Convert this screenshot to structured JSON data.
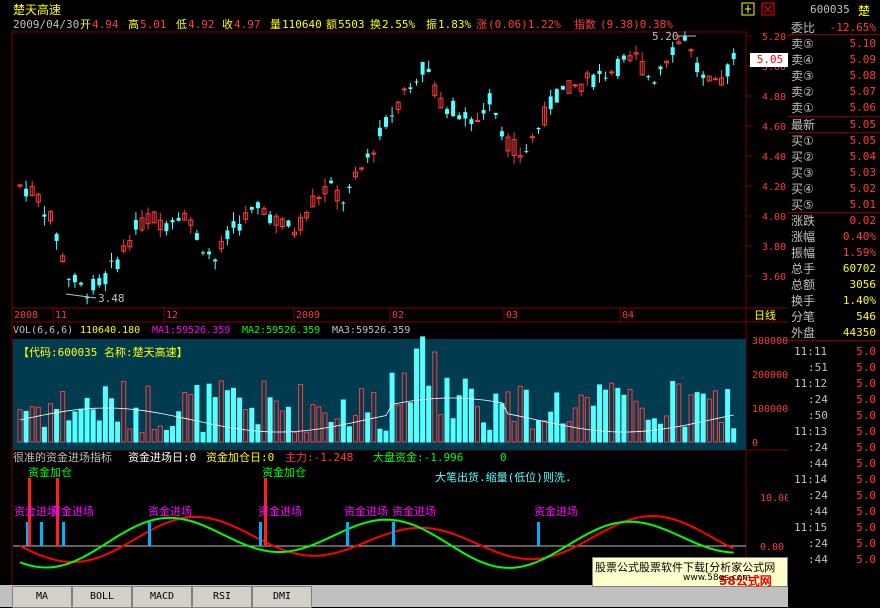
{
  "stock": {
    "name": "楚天高速",
    "code": "600035",
    "name_short": "楚",
    "date": "2009/04/30",
    "open_label": "开",
    "open": "4.94",
    "high_label": "高",
    "high": "5.01",
    "low_label": "低",
    "low": "4.92",
    "close_label": "收",
    "close": "4.97",
    "vol_label": "量",
    "vol": "110640",
    "amt_label": "额",
    "amt": "5503",
    "turn_label": "换",
    "turn": "2.55%",
    "amp_label": "振",
    "amp": "1.83%",
    "chg_label": "涨",
    "chg": "(0.06)1.22%",
    "idx_label": "指数",
    "idx": "(9.38)0.38%"
  },
  "price_axis": [
    "5.20",
    "5.00",
    "4.80",
    "4.60",
    "4.40",
    "4.20",
    "4.00",
    "3.80",
    "3.60"
  ],
  "current_price_tag": "5.05",
  "annotations": {
    "high": "5.20",
    "low": "3.48"
  },
  "date_axis": [
    "2008",
    "11",
    "12",
    "2009",
    "02",
    "03",
    "04"
  ],
  "period_label": "日线",
  "vol_panel": {
    "header": "VOL(6,6,6)",
    "vol": "110640.180",
    "ma1": "MA1:59526.359",
    "ma2": "MA2:59526.359",
    "ma3": "MA3:59526.359",
    "info": "【代码:600035  名称:楚天高速】",
    "axis": [
      "300000",
      "200000",
      "100000",
      "0"
    ]
  },
  "ind_panel": {
    "title": "很准的资金进场指标",
    "t1": "资金进场日:0",
    "t2": "资金加仓日:0",
    "t3": "主力:-1.248",
    "t4": "大盘资金:-1.996",
    "t4_suffix": "0",
    "note": "大笔出货.缩量(低位)则洗.",
    "jc": "资金进场",
    "jia": "资金加仓",
    "axis": [
      "10.00",
      "0.00"
    ]
  },
  "quote": {
    "weibi_label": "委比",
    "weibi": "-12.65%",
    "asks": [
      {
        "l": "卖⑤",
        "v": "5.10"
      },
      {
        "l": "卖④",
        "v": "5.09"
      },
      {
        "l": "卖③",
        "v": "5.08"
      },
      {
        "l": "卖②",
        "v": "5.07"
      },
      {
        "l": "卖①",
        "v": "5.06"
      }
    ],
    "last_label": "最新",
    "last": "5.05",
    "bids": [
      {
        "l": "买①",
        "v": "5.05"
      },
      {
        "l": "买②",
        "v": "5.04"
      },
      {
        "l": "买③",
        "v": "5.03"
      },
      {
        "l": "买④",
        "v": "5.02"
      },
      {
        "l": "买⑤",
        "v": "5.01"
      }
    ],
    "stats": [
      {
        "l": "涨跌",
        "v": "0.02"
      },
      {
        "l": "涨幅",
        "v": "0.40%"
      },
      {
        "l": "振幅",
        "v": "1.59%"
      },
      {
        "l": "总手",
        "v": "60702"
      },
      {
        "l": "总额",
        "v": "3056"
      },
      {
        "l": "换手",
        "v": "1.40%"
      },
      {
        "l": "分笔",
        "v": "546"
      },
      {
        "l": "外盘",
        "v": "44350"
      }
    ],
    "ticks": [
      {
        "t": "11:11",
        "v": "5.0"
      },
      {
        "t": ":51",
        "v": "5.0"
      },
      {
        "t": "11:12",
        "v": "5.0"
      },
      {
        "t": ":24",
        "v": "5.0"
      },
      {
        "t": ":50",
        "v": "5.0"
      },
      {
        "t": "11:13",
        "v": "5.0"
      },
      {
        "t": ":24",
        "v": "5.0"
      },
      {
        "t": ":44",
        "v": "5.0"
      },
      {
        "t": "11:14",
        "v": "5.0"
      },
      {
        "t": ":24",
        "v": "5.0"
      },
      {
        "t": ":44",
        "v": "5.0"
      },
      {
        "t": "11:15",
        "v": "5.0"
      },
      {
        "t": ":24",
        "v": "5.0"
      },
      {
        "t": ":44",
        "v": "5.0"
      }
    ]
  },
  "tabs": [
    "MA",
    "BOLL",
    "MACD",
    "RSI",
    "DMI"
  ],
  "ad": {
    "text": "股票公式股票软件下载[分析家公式网",
    "brand": "58公式网",
    "url": "www.58gs.com"
  },
  "colors": {
    "up": "#ff3c3c",
    "down": "#54ffff",
    "bg": "#000000",
    "grid": "#800000",
    "label": "#c0c0c0",
    "yellow": "#ffff00",
    "magenta": "#ff00ff",
    "green": "#00ff00"
  },
  "toolbar_icons": [
    "pin-icon",
    "close-icon"
  ]
}
